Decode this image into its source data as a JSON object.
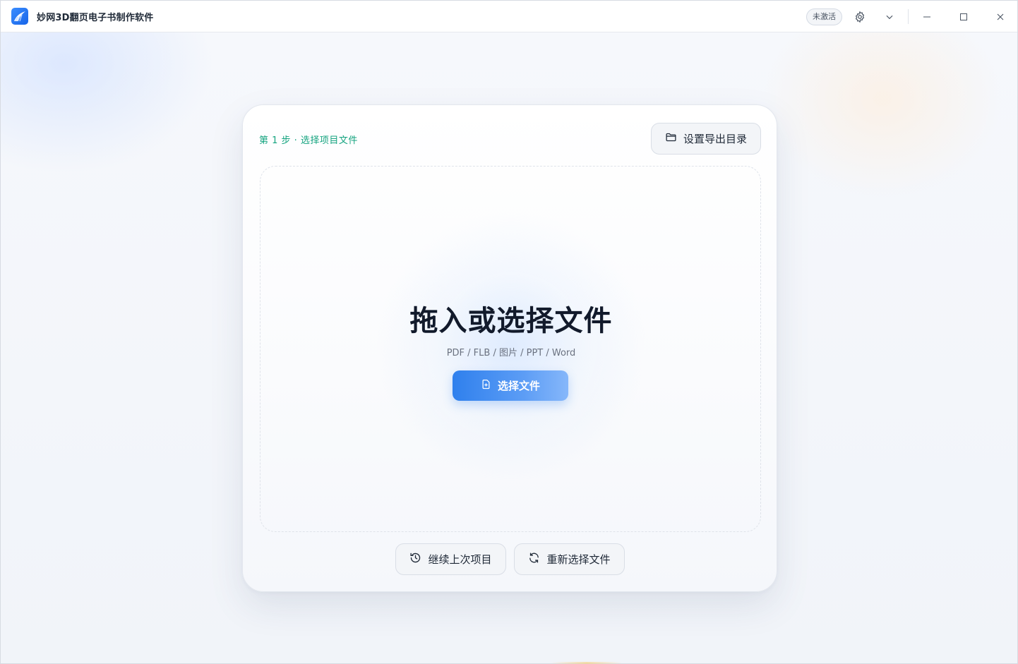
{
  "app": {
    "title": "妙网3D翻页电子书制作软件",
    "brand_color": "#1f6fea"
  },
  "titlebar": {
    "badge": "未激活",
    "icons": [
      "gear-icon",
      "chevron-down-icon",
      "minimize-icon",
      "maximize-icon",
      "close-icon"
    ]
  },
  "card": {
    "step_label": "第 1 步 · 选择项目文件",
    "export_button": "设置导出目录",
    "dropzone": {
      "title": "拖入或选择文件",
      "formats": "PDF / FLB / 图片 / PPT / Word",
      "choose_button": "选择文件"
    },
    "continue_button": "继续上次项目",
    "reselect_button": "重新选择文件"
  },
  "colors": {
    "step_accent": "#14a37f",
    "primary_button": "#2f80ed"
  }
}
